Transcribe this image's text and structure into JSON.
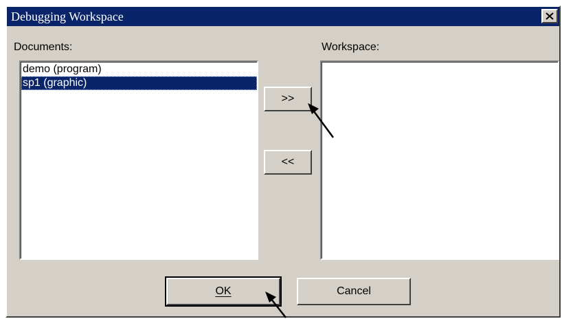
{
  "window": {
    "title": "Debugging Workspace",
    "close_icon": "close-icon"
  },
  "documents": {
    "label": "Documents:",
    "items": [
      {
        "text": "demo (program)",
        "selected": false
      },
      {
        "text": "sp1 (graphic)",
        "selected": true
      }
    ]
  },
  "workspace": {
    "label": "Workspace:",
    "items": []
  },
  "buttons": {
    "add": ">>",
    "remove": "<<",
    "ok": "OK",
    "cancel": "Cancel"
  },
  "colors": {
    "titlebar": "#0a246a",
    "face": "#d4d0c8",
    "selection": "#0a246a"
  }
}
